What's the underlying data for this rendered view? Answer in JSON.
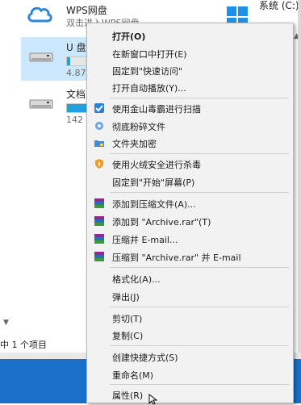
{
  "explorer": {
    "wps": {
      "name": "WPS网盘",
      "sub": "双击进入WPS网盘"
    },
    "udisk": {
      "name": "U 盘",
      "capacity_text": "4.87",
      "used_fraction": 0.02
    },
    "docs": {
      "name": "文档",
      "capacity_text": "142",
      "used_fraction": 0.25
    },
    "system_drive": {
      "label": "系统 (C:)"
    },
    "statusbar": {
      "text": "中 1 个项目"
    }
  },
  "context_menu": {
    "items": [
      {
        "label": "打开(O)",
        "icon": ""
      },
      {
        "label": "在新窗口中打开(E)",
        "icon": ""
      },
      {
        "label": "固定到\"快速访问\"",
        "icon": ""
      },
      {
        "label": "打开自动播放(Y)...",
        "icon": ""
      },
      {
        "label": "使用金山毒霸进行扫描",
        "icon": "kingsoft-shield-icon"
      },
      {
        "label": "彻底粉碎文件",
        "icon": "shredder-icon"
      },
      {
        "label": "文件夹加密",
        "icon": "folder-lock-icon"
      },
      {
        "label": "使用火绒安全进行杀毒",
        "icon": "huorong-icon"
      },
      {
        "label": "固定到\"开始\"屏幕(P)",
        "icon": ""
      },
      {
        "label": "添加到压缩文件(A)...",
        "icon": "winrar-icon"
      },
      {
        "label": "添加到 \"Archive.rar\"(T)",
        "icon": "winrar-icon"
      },
      {
        "label": "压缩并 E-mail...",
        "icon": "winrar-icon"
      },
      {
        "label": "压缩到 \"Archive.rar\" 并 E-mail",
        "icon": "winrar-icon"
      },
      {
        "label": "格式化(A)...",
        "icon": ""
      },
      {
        "label": "弹出(J)",
        "icon": ""
      },
      {
        "label": "剪切(T)",
        "icon": ""
      },
      {
        "label": "复制(C)",
        "icon": ""
      },
      {
        "label": "创建快捷方式(S)",
        "icon": ""
      },
      {
        "label": "重命名(M)",
        "icon": ""
      },
      {
        "label": "属性(R)",
        "icon": ""
      }
    ]
  },
  "colors": {
    "selection": "#cce8ff",
    "capacity_fill": "#26a0da",
    "menu_background": "#f2f2f2",
    "taskbar": "#1a6fc9"
  }
}
